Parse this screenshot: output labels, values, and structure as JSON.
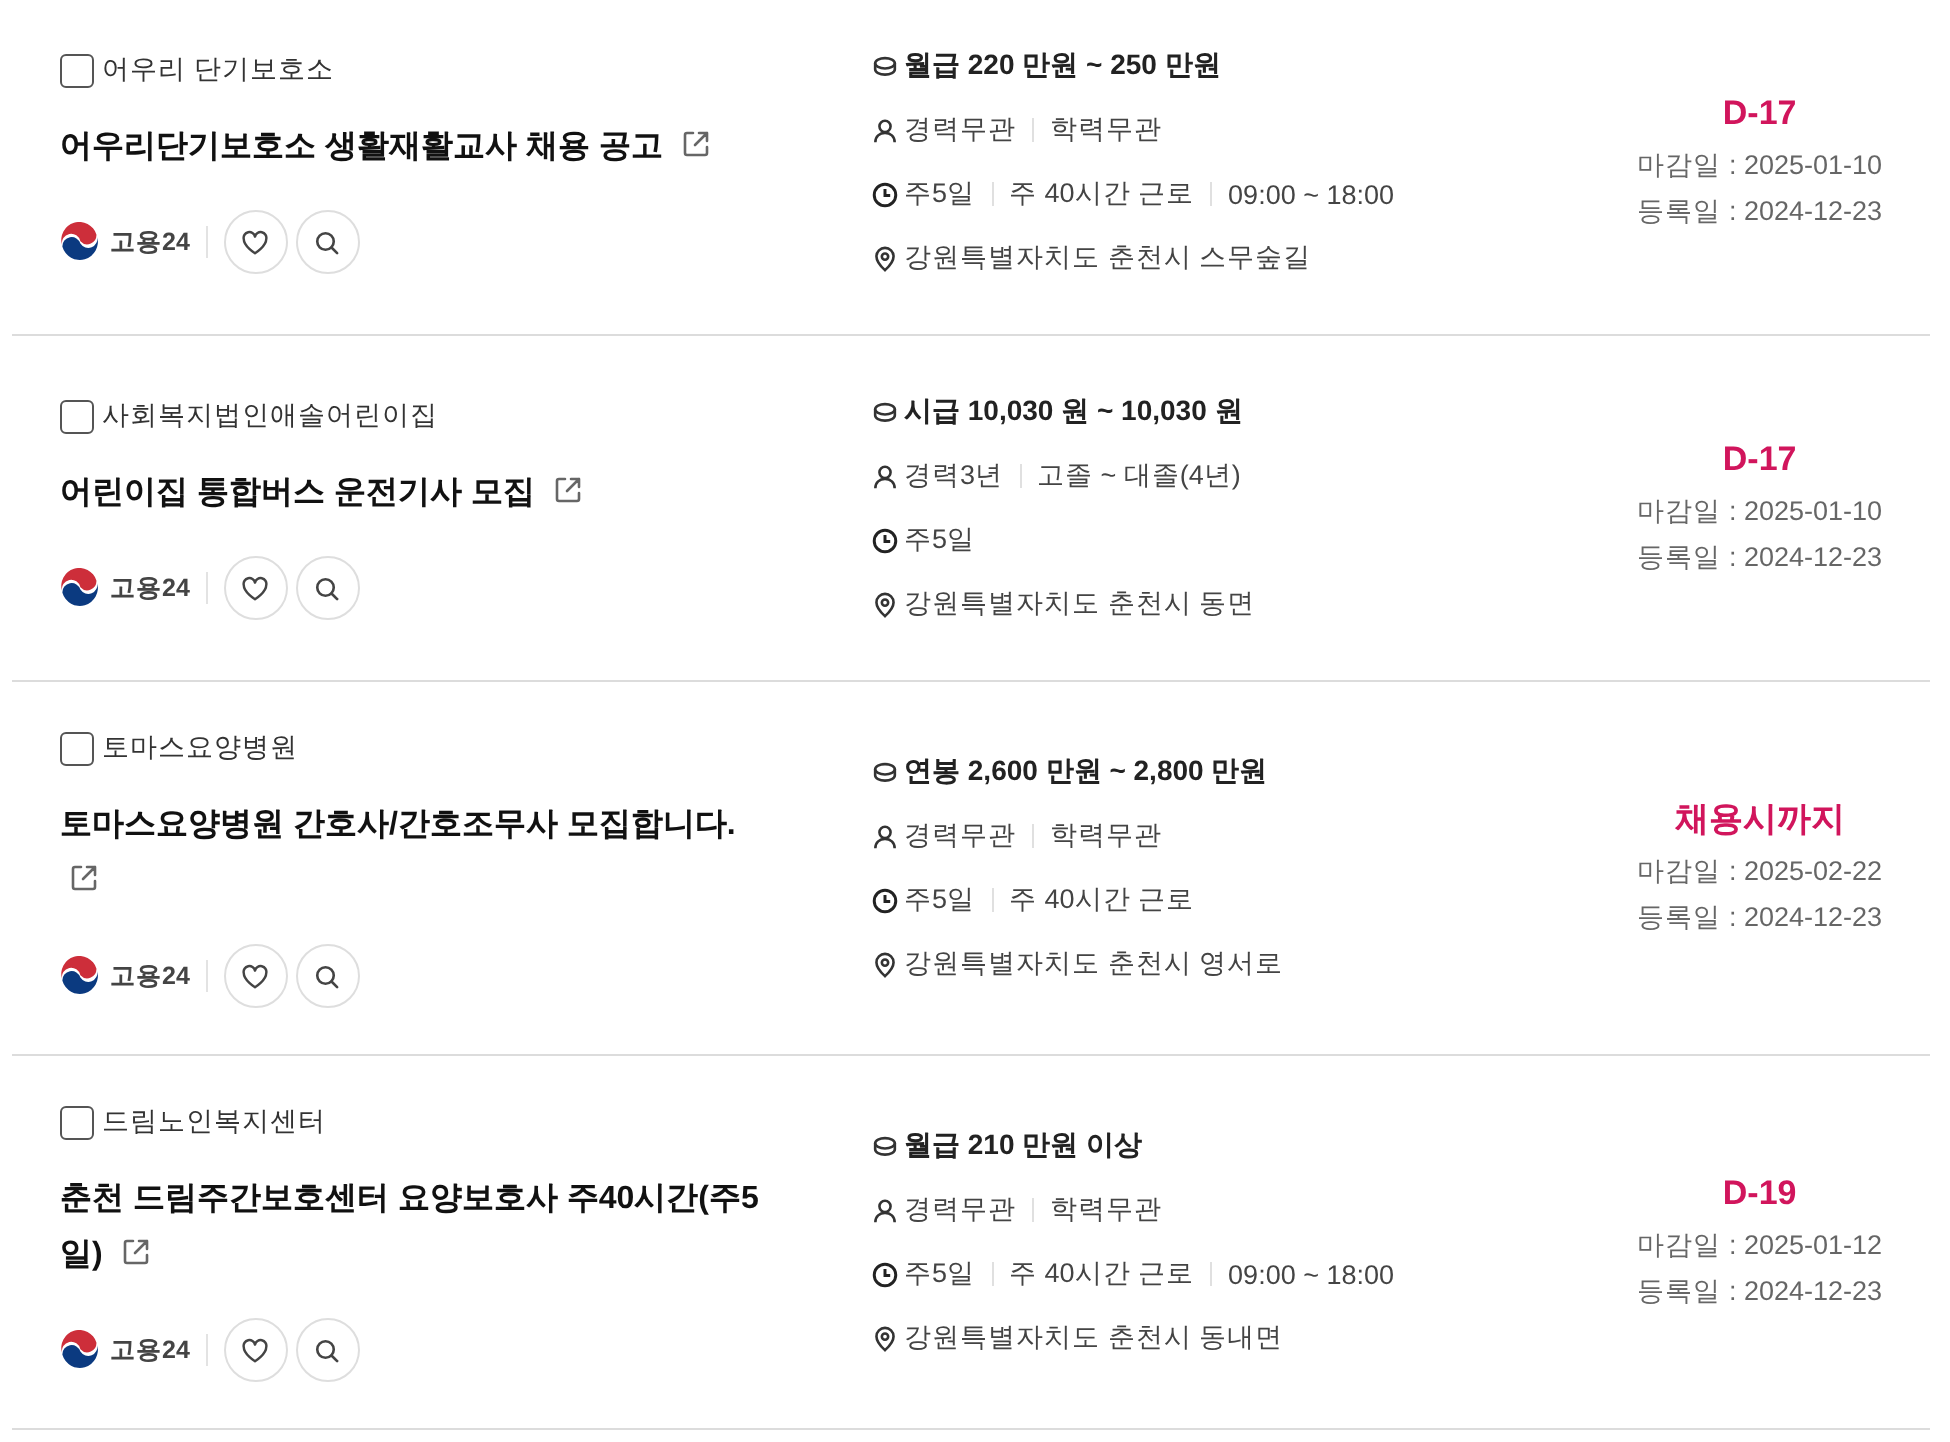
{
  "listings": [
    {
      "company": "어우리 단기보호소",
      "checked": false,
      "title": "어우리단기보호소 생활재활교사 채용 공고",
      "source": "고용24",
      "salary": "월급 220 만원 ~ 250 만원",
      "requirements": [
        "경력무관",
        "학력무관"
      ],
      "schedule": [
        "주5일",
        "주 40시간 근로",
        "09:00 ~ 18:00"
      ],
      "location": "강원특별자치도 춘천시 스무숲길",
      "deadline_badge": "D-17",
      "deadline": "마감일 : 2025-01-10",
      "posted": "등록일 : 2024-12-23"
    },
    {
      "company": "사회복지법인애솔어린이집",
      "checked": false,
      "title": "어린이집 통합버스 운전기사 모집",
      "source": "고용24",
      "salary": "시급 10,030 원 ~ 10,030 원",
      "requirements": [
        "경력3년",
        "고졸 ~ 대졸(4년)"
      ],
      "schedule": [
        "주5일"
      ],
      "location": "강원특별자치도 춘천시 동면",
      "deadline_badge": "D-17",
      "deadline": "마감일 : 2025-01-10",
      "posted": "등록일 : 2024-12-23"
    },
    {
      "company": "토마스요양병원",
      "checked": false,
      "title": "토마스요양병원 간호사/간호조무사 모집합니다.",
      "source": "고용24",
      "salary": "연봉 2,600 만원 ~ 2,800 만원",
      "requirements": [
        "경력무관",
        "학력무관"
      ],
      "schedule": [
        "주5일",
        "주 40시간 근로"
      ],
      "location": "강원특별자치도 춘천시 영서로",
      "deadline_badge": "채용시까지",
      "deadline": "마감일 : 2025-02-22",
      "posted": "등록일 : 2024-12-23"
    },
    {
      "company": "드림노인복지센터",
      "checked": false,
      "title": "춘천 드림주간보호센터 요양보호사 주40시간(주5일)",
      "source": "고용24",
      "salary": "월급 210 만원 이상",
      "requirements": [
        "경력무관",
        "학력무관"
      ],
      "schedule": [
        "주5일",
        "주 40시간 근로",
        "09:00 ~ 18:00"
      ],
      "location": "강원특별자치도 춘천시 동내면",
      "deadline_badge": "D-19",
      "deadline": "마감일 : 2025-01-12",
      "posted": "등록일 : 2024-12-23"
    }
  ]
}
